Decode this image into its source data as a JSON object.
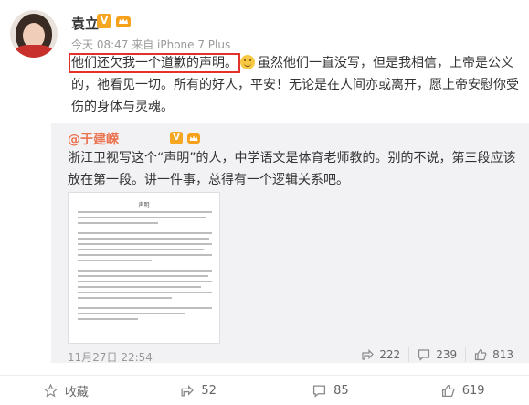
{
  "post": {
    "author": "袁立",
    "vip_letter": "V",
    "meta": "今天 08:47 来自 iPhone 7 Plus",
    "highlight_text": "他们还欠我一个道歉的声明。",
    "body_text": "虽然他们一直没写，但是我相信，上帝是公义的，祂看见一切。所有的好人，平安！无论是在人间亦或离开，愿上帝安慰你受伤的身体与灵魂。"
  },
  "repost": {
    "author": "@于建嵘",
    "vip_letter": "V",
    "text": "浙江卫视写这个“声明”的人，中学语文是体育老师教的。别的不说，第三段应该放在第一段。讲一件事，总得有一个逻辑关系吧。",
    "doc_title": "声明",
    "time": "11月27日 22:54",
    "reposts": "222",
    "comments": "239",
    "likes": "813"
  },
  "footer": {
    "favorite": "收藏",
    "repost_count": "52",
    "comment_count": "85",
    "like_count": "619"
  },
  "colors": {
    "highlight_border": "#e2322a",
    "repost_author": "#eb7350",
    "vip_badge": "#f5a623",
    "repost_bg": "#f2f2f5"
  },
  "icons": [
    "vip-badge-icon",
    "member-crown-icon",
    "smile-emoji-icon",
    "repost-icon",
    "comment-icon",
    "like-icon",
    "favorite-star-icon"
  ]
}
